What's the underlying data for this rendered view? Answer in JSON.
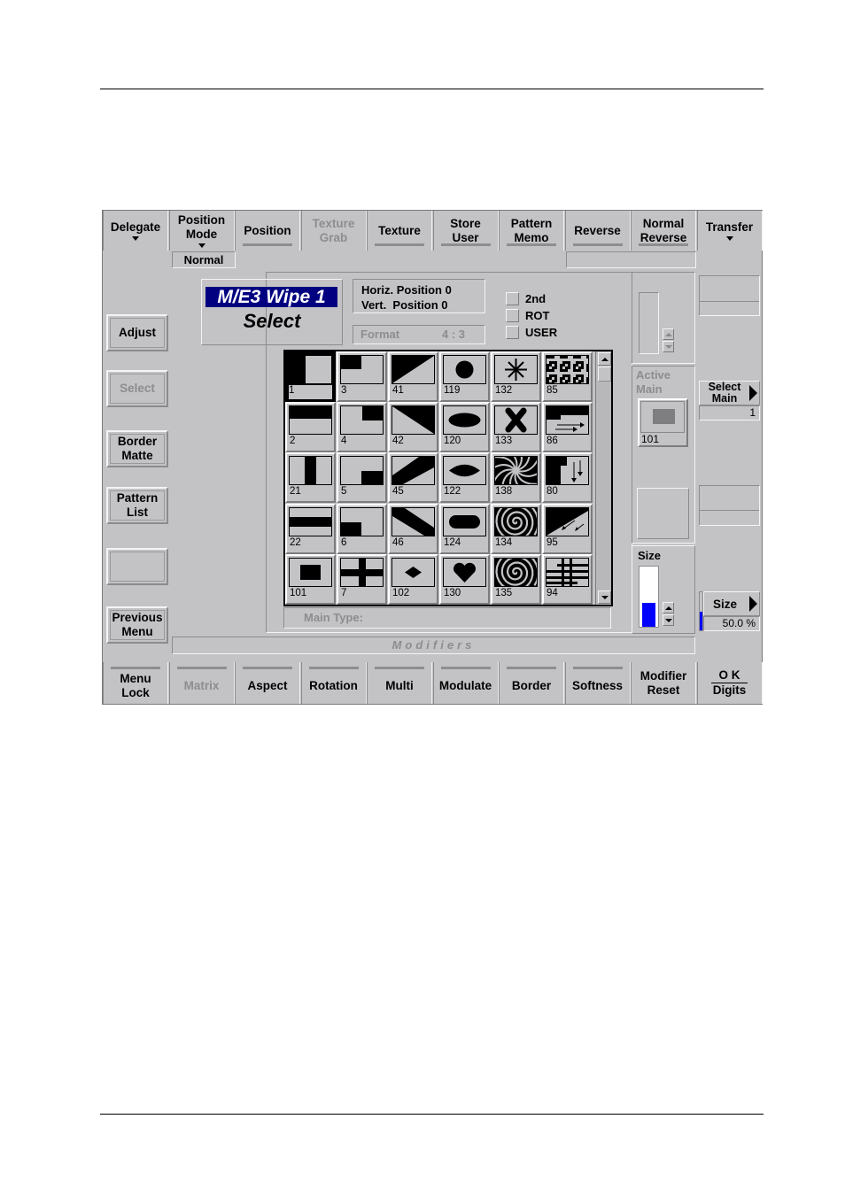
{
  "top_toolbar": [
    {
      "label": "Delegate",
      "dropdown": true,
      "enabled": true,
      "indicator": false
    },
    {
      "label": "Position Mode",
      "dropdown": true,
      "enabled": true,
      "indicator": false
    },
    {
      "label": "Position",
      "dropdown": false,
      "enabled": true,
      "indicator": true
    },
    {
      "label": "Texture Grab",
      "dropdown": false,
      "enabled": false,
      "indicator": false
    },
    {
      "label": "Texture",
      "dropdown": false,
      "enabled": true,
      "indicator": true
    },
    {
      "label": "Store User",
      "dropdown": false,
      "enabled": true,
      "indicator": true
    },
    {
      "label": "Pattern Memo",
      "dropdown": false,
      "enabled": true,
      "indicator": true
    },
    {
      "label": "Reverse",
      "dropdown": false,
      "enabled": true,
      "indicator": true
    },
    {
      "label": "Normal Reverse",
      "dropdown": false,
      "enabled": true,
      "indicator": true
    },
    {
      "label": "Transfer",
      "dropdown": true,
      "enabled": true,
      "indicator": false
    }
  ],
  "position_mode_value": "Normal",
  "left_buttons": [
    {
      "label": "Adjust",
      "enabled": true
    },
    {
      "label": "Select",
      "enabled": false
    },
    {
      "label": "Border Matte",
      "enabled": true
    },
    {
      "label": "Pattern List",
      "enabled": true
    },
    {
      "label": "",
      "enabled": true
    },
    {
      "label": "Previous Menu",
      "enabled": true
    }
  ],
  "title": {
    "line1": "M/E3 Wipe 1",
    "line2": "Select",
    "highlight_color": "#000080"
  },
  "position_info": {
    "horiz": "Horiz. Position 0",
    "vert": "Vert.  Position 0"
  },
  "format": {
    "label": "Format",
    "value": "4 : 3"
  },
  "checkboxes": [
    {
      "label": "2nd",
      "checked": false
    },
    {
      "label": "ROT",
      "checked": false
    },
    {
      "label": "USER",
      "checked": false
    }
  ],
  "pattern_grid": {
    "selected": "1",
    "rows": [
      [
        {
          "num": "1",
          "icon": "corner-l-pattern"
        },
        {
          "num": "3",
          "icon": "top-left-box-pattern"
        },
        {
          "num": "41",
          "icon": "diagonal-up-pattern"
        },
        {
          "num": "119",
          "icon": "circle-pattern"
        },
        {
          "num": "132",
          "icon": "star-pattern"
        },
        {
          "num": "85",
          "icon": "random-noise-pattern"
        }
      ],
      [
        {
          "num": "2",
          "icon": "horizontal-top-pattern"
        },
        {
          "num": "4",
          "icon": "top-right-box-pattern"
        },
        {
          "num": "42",
          "icon": "diagonal-down-pattern"
        },
        {
          "num": "120",
          "icon": "ellipse-pattern"
        },
        {
          "num": "133",
          "icon": "x-cross-pattern"
        },
        {
          "num": "86",
          "icon": "push-right-pattern"
        }
      ],
      [
        {
          "num": "21",
          "icon": "vertical-bar-pattern"
        },
        {
          "num": "5",
          "icon": "bottom-right-box-pattern"
        },
        {
          "num": "45",
          "icon": "diagonal-band-up-pattern"
        },
        {
          "num": "122",
          "icon": "lens-pattern"
        },
        {
          "num": "138",
          "icon": "swirl-pattern"
        },
        {
          "num": "80",
          "icon": "push-down-pattern"
        }
      ],
      [
        {
          "num": "22",
          "icon": "horizontal-bar-pattern"
        },
        {
          "num": "6",
          "icon": "bottom-left-box-pattern"
        },
        {
          "num": "46",
          "icon": "diagonal-band-down-pattern"
        },
        {
          "num": "124",
          "icon": "rounded-rect-pattern"
        },
        {
          "num": "134",
          "icon": "spiral-pattern"
        },
        {
          "num": "95",
          "icon": "staircase-diagonal-pattern"
        }
      ],
      [
        {
          "num": "101",
          "icon": "center-box-pattern"
        },
        {
          "num": "7",
          "icon": "cross-pattern"
        },
        {
          "num": "102",
          "icon": "diamond-pattern"
        },
        {
          "num": "130",
          "icon": "heart-pattern"
        },
        {
          "num": "135",
          "icon": "spiral-large-pattern"
        },
        {
          "num": "94",
          "icon": "grid-lines-pattern"
        }
      ]
    ]
  },
  "main_type_label": "Main Type:",
  "modifiers_label": "Modifiers",
  "active_main": {
    "label": "Active Main",
    "value": "101"
  },
  "size_control": {
    "label": "Size",
    "fraction": 0.5
  },
  "right_panel": {
    "select_main": {
      "label": "Select Main",
      "value": "1"
    },
    "size": {
      "label": "Size",
      "value": "50.0 %",
      "fraction": 0.5
    }
  },
  "bottom_toolbar": [
    {
      "label": "Menu Lock",
      "enabled": true,
      "indicator": true
    },
    {
      "label": "Matrix",
      "enabled": false,
      "indicator": true
    },
    {
      "label": "Aspect",
      "enabled": true,
      "indicator": true
    },
    {
      "label": "Rotation",
      "enabled": true,
      "indicator": true
    },
    {
      "label": "Multi",
      "enabled": true,
      "indicator": true
    },
    {
      "label": "Modulate",
      "enabled": true,
      "indicator": true
    },
    {
      "label": "Border",
      "enabled": true,
      "indicator": true
    },
    {
      "label": "Softness",
      "enabled": true,
      "indicator": true
    },
    {
      "label": "Modifier Reset",
      "enabled": true,
      "indicator": false
    },
    {
      "label": "O K",
      "label2": "Digits",
      "enabled": true,
      "indicator": false
    }
  ],
  "colors": {
    "panel_bg": "#c3c3c6",
    "accent_blue": "#0000ff",
    "title_bg": "#000080"
  }
}
